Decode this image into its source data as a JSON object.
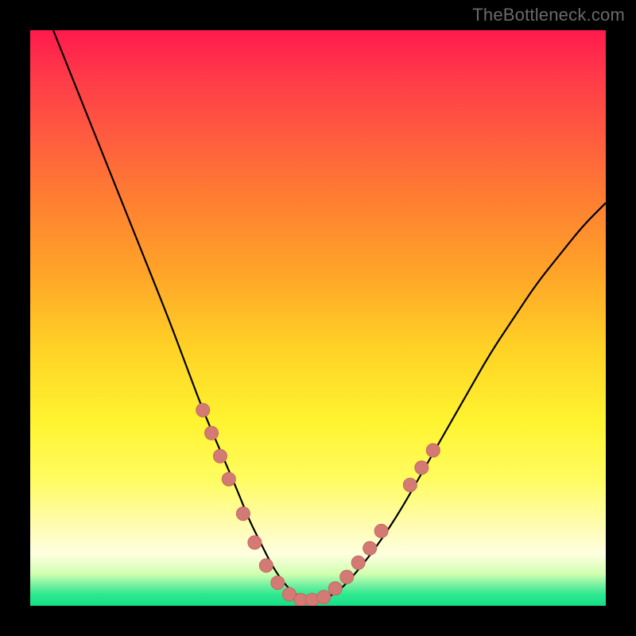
{
  "watermark": {
    "text": "TheBottleneck.com"
  },
  "colors": {
    "frame": "#000000",
    "curve": "#000000",
    "marker_fill": "#d47a74",
    "marker_stroke": "#c46860"
  },
  "chart_data": {
    "type": "line",
    "title": "",
    "xlabel": "",
    "ylabel": "",
    "xlim": [
      0,
      100
    ],
    "ylim": [
      0,
      100
    ],
    "grid": false,
    "legend": false,
    "series": [
      {
        "name": "bottleneck-curve",
        "x": [
          4,
          8,
          12,
          16,
          20,
          24,
          27,
          30,
          33,
          36,
          38,
          40,
          42,
          44,
          46,
          48,
          50,
          53,
          56,
          60,
          64,
          68,
          72,
          76,
          80,
          84,
          88,
          92,
          96,
          100
        ],
        "y": [
          100,
          90,
          80,
          70,
          60,
          50,
          42,
          34,
          27,
          20,
          15,
          11,
          7,
          4,
          2,
          1,
          1,
          2,
          5,
          10,
          16,
          23,
          30,
          37,
          44,
          50,
          56,
          61,
          66,
          70
        ]
      }
    ],
    "markers": {
      "name": "highlighted-points",
      "points": [
        {
          "x": 30,
          "y": 34
        },
        {
          "x": 31.5,
          "y": 30
        },
        {
          "x": 33,
          "y": 26
        },
        {
          "x": 34.5,
          "y": 22
        },
        {
          "x": 37,
          "y": 16
        },
        {
          "x": 39,
          "y": 11
        },
        {
          "x": 41,
          "y": 7
        },
        {
          "x": 43,
          "y": 4
        },
        {
          "x": 45,
          "y": 2
        },
        {
          "x": 47,
          "y": 1
        },
        {
          "x": 49,
          "y": 1
        },
        {
          "x": 51,
          "y": 1.5
        },
        {
          "x": 53,
          "y": 3
        },
        {
          "x": 55,
          "y": 5
        },
        {
          "x": 57,
          "y": 7.5
        },
        {
          "x": 59,
          "y": 10
        },
        {
          "x": 61,
          "y": 13
        },
        {
          "x": 66,
          "y": 21
        },
        {
          "x": 68,
          "y": 24
        },
        {
          "x": 70,
          "y": 27
        }
      ]
    }
  }
}
